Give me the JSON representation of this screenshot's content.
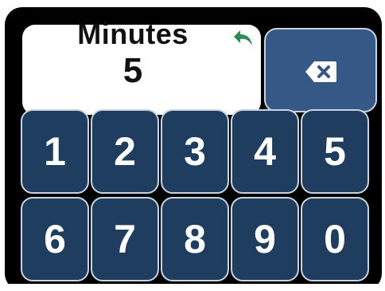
{
  "display": {
    "label": "Minutes",
    "value": "5"
  },
  "icons": {
    "undo": "undo-arrow-icon",
    "backspace": "backspace-icon"
  },
  "keypad": {
    "keys": [
      "1",
      "2",
      "3",
      "4",
      "5",
      "6",
      "7",
      "8",
      "9",
      "0"
    ]
  },
  "colors": {
    "frame": "#000000",
    "key_background": "#1f3d5e",
    "backspace_background": "#355887",
    "undo_arrow": "#2e8b57",
    "key_text": "#ffffff"
  }
}
